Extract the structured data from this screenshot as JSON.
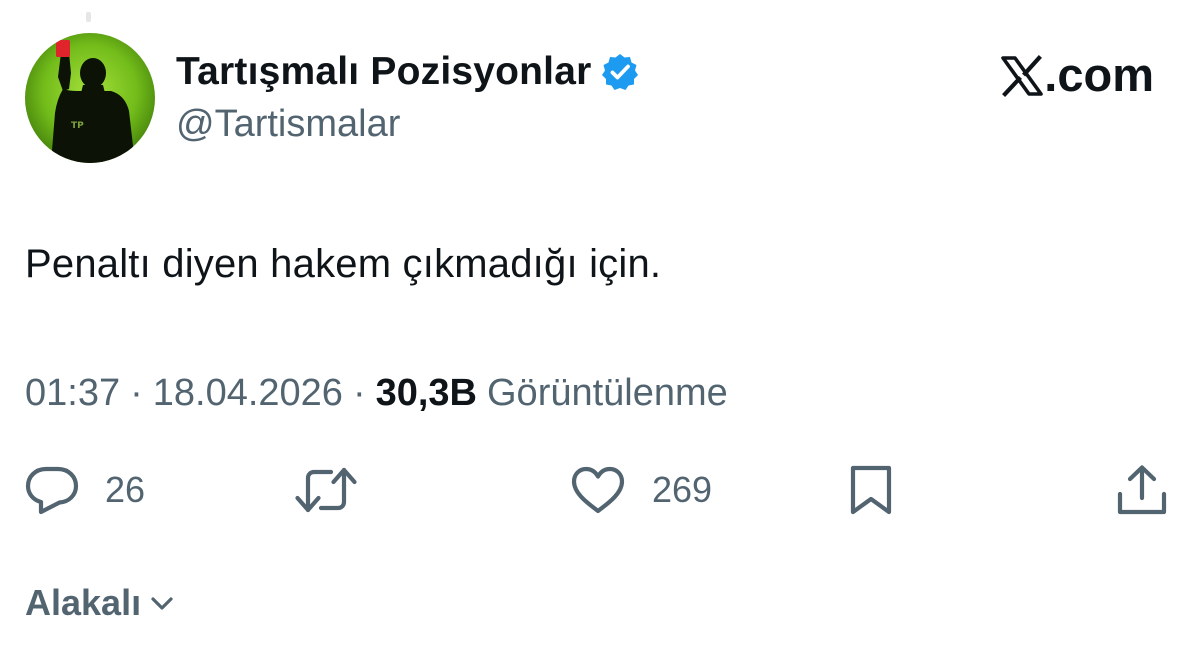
{
  "tweet": {
    "author": {
      "display_name": "Tartışmalı Pozisyonlar",
      "handle": "@Tartismalar",
      "verified": true,
      "avatar_initials": "TP"
    },
    "brand": {
      "label": ".com",
      "logo_icon": "x-logo-icon"
    },
    "text": "Penaltı diyen hakem çıkmadığı için.",
    "meta": {
      "time": "01:37",
      "separator": "·",
      "date": "18.04.2026",
      "views_count": "30,3B",
      "views_label": "Görüntülenme"
    },
    "actions": {
      "reply": {
        "icon": "reply-icon",
        "count": "26"
      },
      "retweet": {
        "icon": "retweet-icon"
      },
      "like": {
        "icon": "heart-icon",
        "count": "269"
      },
      "bookmark": {
        "icon": "bookmark-icon"
      },
      "share": {
        "icon": "share-icon"
      }
    },
    "related": {
      "label": "Alakalı",
      "icon": "chevron-down-icon"
    }
  },
  "colors": {
    "text_primary": "#0f1419",
    "text_secondary": "#536471",
    "verified_blue": "#1d9bf0",
    "avatar_green": "#76c21b",
    "card_red": "#e0242b"
  }
}
